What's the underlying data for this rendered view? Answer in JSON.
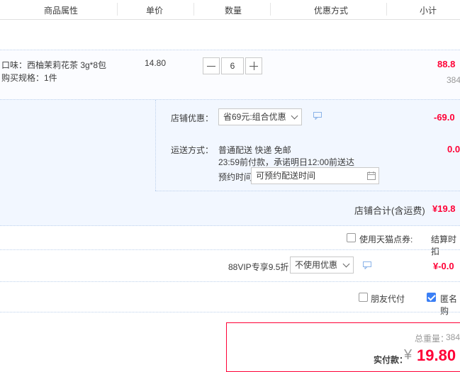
{
  "header": {
    "attr": "商品属性",
    "unit_price": "单价",
    "quantity": "数量",
    "discount": "优惠方式",
    "subtotal": "小计"
  },
  "item": {
    "flavor": "口味：西柚茉莉花茶 3g*8包",
    "spec": "购买规格：1件",
    "price": "14.80",
    "quantity": "6",
    "subtotal": "88.8",
    "weight": "384"
  },
  "shop": {
    "discount_label": "店铺优惠：",
    "discount_option": "省69元:组合优惠",
    "discount_amount": "-69.0",
    "shipping_label": "运送方式：",
    "shipping_method": "普通配送 快递 免邮",
    "shipping_promise": "23:59前付款，承诺明日12:00前送达",
    "shipping_amount": "0.0",
    "schedule_label": "预约时间",
    "schedule_placeholder": "可预约配送时间",
    "total_label": "店铺合计(含运费)",
    "total_value": "¥19.8"
  },
  "points": {
    "label": "使用天猫点券:",
    "right_text": "结算时扣"
  },
  "vip": {
    "label": "88VIP专享9.5折",
    "option": "不使用优惠",
    "amount": "¥-0.0"
  },
  "options": {
    "friend_pay": "朋友代付",
    "anonymous": "匿名购"
  },
  "summary": {
    "weight_label": "总重量：",
    "weight_value": "384",
    "pay_label": "实付款：",
    "currency": "¥",
    "pay_value": "19.80"
  },
  "colors": {
    "price_red": "#ff0036",
    "checkbox_blue": "#3b7ff5",
    "panel_bg": "#f2f7ff"
  }
}
